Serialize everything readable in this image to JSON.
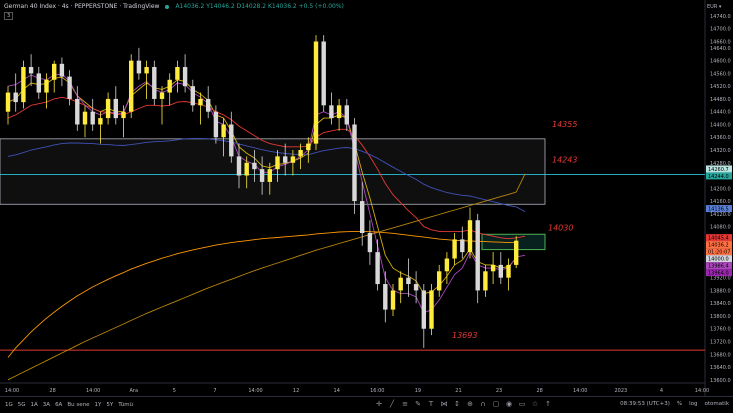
{
  "header": {
    "title": "German 40 Index · 4s · PEPPERSTONE · TradingView",
    "ohlc": "A14036.2  Y14046.2  D14028.2  K14036.2  +0.5 (+0.00%)",
    "badge": "3"
  },
  "currency": "EUR ▾",
  "price_axis": {
    "ticks": [
      "14780.0",
      "14740.0",
      "14700.0",
      "14660.0",
      "14640.0",
      "14600.0",
      "14560.0",
      "14520.0",
      "14480.0",
      "14440.0",
      "14400.0",
      "14360.0",
      "14320.0",
      "14280.0",
      "14240.0",
      "14200.0",
      "14160.0",
      "14120.0",
      "14080.0",
      "14040.0",
      "14000.0",
      "13960.0",
      "13920.0",
      "13880.0",
      "13840.0",
      "13800.0",
      "13760.0",
      "13720.0",
      "13680.0",
      "13640.0",
      "13600.0"
    ],
    "ylim": [
      13590,
      14790
    ]
  },
  "price_labels": [
    {
      "text": "14260.7",
      "value": 14260.7,
      "color": "#b9e3e0"
    },
    {
      "text": "14244.0",
      "value": 14244.0,
      "color": "#26a69a"
    },
    {
      "text": "14136.5",
      "value": 14136.5,
      "color": "#5b7fd6"
    },
    {
      "text": "14045.4",
      "value": 14045.4,
      "color": "#e53935"
    },
    {
      "text": "14036.2",
      "value": 14036.2,
      "color": "#ff7043"
    },
    {
      "text": "01:20:07",
      "value": 14026.0,
      "color": "#ff7043"
    },
    {
      "text": "14000.0",
      "value": 14000.0,
      "color": "#d1d4dc"
    },
    {
      "text": "13986.4",
      "value": 13986.4,
      "color": "#ab47bc"
    },
    {
      "text": "13964.0",
      "value": 13964.0,
      "color": "#9c27b0"
    }
  ],
  "time_axis": {
    "labels": [
      "14:00",
      "28",
      "14:00",
      "Ara",
      "5",
      "7",
      "14:00",
      "12",
      "14",
      "16:00",
      "19",
      "21",
      "23",
      "28",
      "14:00",
      "2023",
      "4",
      "14:00"
    ]
  },
  "annotations": [
    {
      "text": "14355",
      "value": 14355
    },
    {
      "text": "14243",
      "value": 14243
    },
    {
      "text": "14030",
      "value": 14030
    },
    {
      "text": "13693",
      "value": 13693
    }
  ],
  "zones": [
    {
      "name": "upper-zone",
      "top": 14355,
      "bottom": 14150
    },
    {
      "name": "lower-zone",
      "top": 14056,
      "bottom": 14008
    }
  ],
  "lines": [
    {
      "name": "support-line",
      "value": 13693,
      "color": "#e53935"
    },
    {
      "name": "resistance-line",
      "value": 14243,
      "color": "#26c6da"
    }
  ],
  "chart_data": {
    "type": "candlestick",
    "candles": [
      [
        14440,
        14520,
        14400,
        14500
      ],
      [
        14500,
        14560,
        14440,
        14470
      ],
      [
        14470,
        14600,
        14450,
        14580
      ],
      [
        14580,
        14620,
        14520,
        14560
      ],
      [
        14560,
        14580,
        14480,
        14500
      ],
      [
        14500,
        14560,
        14450,
        14540
      ],
      [
        14540,
        14600,
        14500,
        14590
      ],
      [
        14590,
        14610,
        14520,
        14550
      ],
      [
        14550,
        14570,
        14460,
        14480
      ],
      [
        14480,
        14520,
        14380,
        14400
      ],
      [
        14400,
        14460,
        14360,
        14440
      ],
      [
        14440,
        14480,
        14380,
        14400
      ],
      [
        14400,
        14440,
        14340,
        14420
      ],
      [
        14420,
        14500,
        14400,
        14480
      ],
      [
        14480,
        14520,
        14400,
        14420
      ],
      [
        14420,
        14460,
        14360,
        14440
      ],
      [
        14440,
        14620,
        14420,
        14600
      ],
      [
        14600,
        14640,
        14540,
        14560
      ],
      [
        14560,
        14600,
        14480,
        14580
      ],
      [
        14580,
        14600,
        14460,
        14480
      ],
      [
        14480,
        14520,
        14400,
        14500
      ],
      [
        14500,
        14560,
        14460,
        14540
      ],
      [
        14540,
        14600,
        14500,
        14580
      ],
      [
        14580,
        14620,
        14500,
        14520
      ],
      [
        14520,
        14540,
        14440,
        14460
      ],
      [
        14460,
        14500,
        14400,
        14480
      ],
      [
        14480,
        14520,
        14420,
        14440
      ],
      [
        14440,
        14460,
        14340,
        14360
      ],
      [
        14360,
        14420,
        14300,
        14400
      ],
      [
        14400,
        14440,
        14280,
        14300
      ],
      [
        14300,
        14340,
        14200,
        14240
      ],
      [
        14240,
        14300,
        14200,
        14280
      ],
      [
        14280,
        14320,
        14220,
        14260
      ],
      [
        14260,
        14300,
        14180,
        14220
      ],
      [
        14220,
        14280,
        14180,
        14260
      ],
      [
        14260,
        14320,
        14220,
        14300
      ],
      [
        14300,
        14340,
        14240,
        14280
      ],
      [
        14280,
        14320,
        14240,
        14300
      ],
      [
        14300,
        14340,
        14260,
        14320
      ],
      [
        14320,
        14360,
        14280,
        14340
      ],
      [
        14340,
        14680,
        14320,
        14660
      ],
      [
        14660,
        14680,
        14440,
        14460
      ],
      [
        14460,
        14500,
        14400,
        14420
      ],
      [
        14420,
        14480,
        14380,
        14460
      ],
      [
        14460,
        14480,
        14380,
        14400
      ],
      [
        14400,
        14420,
        14120,
        14160
      ],
      [
        14160,
        14220,
        14020,
        14060
      ],
      [
        14060,
        14100,
        13960,
        14000
      ],
      [
        14000,
        14040,
        13880,
        13900
      ],
      [
        13900,
        13940,
        13780,
        13820
      ],
      [
        13820,
        13900,
        13800,
        13880
      ],
      [
        13880,
        13940,
        13840,
        13920
      ],
      [
        13920,
        13980,
        13860,
        13900
      ],
      [
        13900,
        13940,
        13840,
        13880
      ],
      [
        13880,
        13900,
        13700,
        13760
      ],
      [
        13760,
        13900,
        13740,
        13880
      ],
      [
        13880,
        13960,
        13860,
        13940
      ],
      [
        13940,
        14000,
        13900,
        13980
      ],
      [
        13980,
        14060,
        13960,
        14040
      ],
      [
        14040,
        14080,
        13980,
        14000
      ],
      [
        14000,
        14140,
        13980,
        14100
      ],
      [
        14100,
        14120,
        13840,
        13880
      ],
      [
        13880,
        13960,
        13860,
        13940
      ],
      [
        13940,
        14000,
        13900,
        13960
      ],
      [
        13960,
        14000,
        13900,
        13920
      ],
      [
        13920,
        13980,
        13880,
        13960
      ],
      [
        13960,
        14050,
        13950,
        14036
      ]
    ],
    "series": [
      {
        "name": "ema-fast",
        "color": "#d4b106",
        "values": [
          14470,
          14480,
          14510,
          14530,
          14525,
          14528,
          14545,
          14548,
          14530,
          14490,
          14470,
          14450,
          14440,
          14450,
          14440,
          14440,
          14490,
          14510,
          14530,
          14515,
          14510,
          14520,
          14540,
          14535,
          14510,
          14495,
          14475,
          14430,
          14420,
          14380,
          14330,
          14310,
          14295,
          14270,
          14265,
          14275,
          14278,
          14285,
          14295,
          14310,
          14400,
          14420,
          14420,
          14430,
          14420,
          14340,
          14250,
          14170,
          14080,
          13990,
          13950,
          13935,
          13925,
          13910,
          13870,
          13875,
          13895,
          13925,
          13960,
          13975,
          14010,
          13970,
          13960,
          13960,
          13950,
          13955,
          13980
        ]
      },
      {
        "name": "ema-mid",
        "color": "#e53935",
        "values": [
          14420,
          14430,
          14445,
          14460,
          14465,
          14470,
          14480,
          14485,
          14480,
          14470,
          14460,
          14450,
          14440,
          14438,
          14432,
          14430,
          14440,
          14450,
          14460,
          14460,
          14458,
          14460,
          14470,
          14472,
          14468,
          14462,
          14455,
          14440,
          14430,
          14415,
          14395,
          14380,
          14365,
          14350,
          14340,
          14335,
          14330,
          14330,
          14330,
          14332,
          14360,
          14375,
          14380,
          14385,
          14385,
          14365,
          14335,
          14300,
          14260,
          14215,
          14180,
          14155,
          14130,
          14108,
          14080,
          14070,
          14065,
          14065,
          14065,
          14065,
          14070,
          14060,
          14055,
          14050,
          14045,
          14042,
          14045
        ]
      },
      {
        "name": "ema-slow",
        "color": "#3f51b5",
        "values": [
          14300,
          14305,
          14312,
          14320,
          14325,
          14330,
          14336,
          14340,
          14342,
          14342,
          14341,
          14340,
          14338,
          14337,
          14335,
          14334,
          14337,
          14340,
          14344,
          14346,
          14347,
          14349,
          14352,
          14355,
          14356,
          14356,
          14355,
          14352,
          14349,
          14345,
          14339,
          14333,
          14327,
          14321,
          14316,
          14312,
          14309,
          14307,
          14306,
          14305,
          14312,
          14318,
          14322,
          14326,
          14328,
          14324,
          14316,
          14306,
          14294,
          14280,
          14266,
          14253,
          14240,
          14228,
          14213,
          14202,
          14194,
          14187,
          14182,
          14178,
          14176,
          14170,
          14164,
          14158,
          14152,
          14146,
          14142
        ]
      },
      {
        "name": "ema-purple",
        "color": "#ab47bc",
        "values": [
          14520,
          14525,
          14540,
          14555,
          14545,
          14540,
          14555,
          14558,
          14535,
          14490,
          14460,
          14440,
          14430,
          14440,
          14435,
          14435,
          14500,
          14520,
          14535,
          14510,
          14500,
          14510,
          14530,
          14525,
          14500,
          14485,
          14465,
          14410,
          14400,
          14360,
          14300,
          14285,
          14275,
          14250,
          14250,
          14268,
          14275,
          14285,
          14300,
          14320,
          14430,
          14440,
          14430,
          14440,
          14420,
          14320,
          14220,
          14120,
          14020,
          13920,
          13880,
          13870,
          13870,
          13860,
          13810,
          13820,
          13850,
          13890,
          13930,
          13950,
          14000,
          13960,
          13950,
          13950,
          13945,
          13950,
          13985
        ]
      },
      {
        "name": "sma-long",
        "color": "#ff9800",
        "values": [
          13670,
          13700,
          13725,
          13750,
          13772,
          13793,
          13812,
          13830,
          13847,
          13863,
          13877,
          13891,
          13903,
          13915,
          13926,
          13936,
          13947,
          13956,
          13965,
          13973,
          13981,
          13988,
          13995,
          14001,
          14007,
          14012,
          14017,
          14022,
          14026,
          14030,
          14033,
          14036,
          14039,
          14042,
          14044,
          14046,
          14048,
          14050,
          14052,
          14054,
          14057,
          14059,
          14061,
          14063,
          14064,
          14065,
          14065,
          14064,
          14063,
          14061,
          14059,
          14056,
          14053,
          14050,
          14047,
          14044,
          14041,
          14039,
          14037,
          14036,
          14035,
          14034,
          14033,
          14032,
          14031,
          14030,
          14030
        ]
      },
      {
        "name": "sma-longer",
        "color": "#b8860b",
        "values": [
          13600,
          13612,
          13624,
          13636,
          13648,
          13660,
          13672,
          13684,
          13696,
          13708,
          13720,
          13731,
          13742,
          13753,
          13764,
          13775,
          13786,
          13797,
          13808,
          13818,
          13828,
          13838,
          13848,
          13858,
          13868,
          13878,
          13888,
          13897,
          13906,
          13915,
          13924,
          13933,
          13942,
          13950,
          13958,
          13966,
          13974,
          13982,
          13990,
          13998,
          14006,
          14013,
          14020,
          14027,
          14034,
          14041,
          14048,
          14055,
          14062,
          14069,
          14076,
          14083,
          14090,
          14097,
          14104,
          14111,
          14118,
          14125,
          14132,
          14139,
          14146,
          14153,
          14160,
          14167,
          14174,
          14181,
          14188
        ]
      }
    ],
    "projections": [
      {
        "name": "sma-longer-proj",
        "color": "#b8860b",
        "values": [
          14188,
          14245
        ]
      },
      {
        "name": "ema-slow-proj",
        "color": "#3f51b5",
        "values": [
          14142,
          14127
        ]
      },
      {
        "name": "ema-mid-proj",
        "color": "#e53935",
        "values": [
          14045,
          14050
        ]
      },
      {
        "name": "ema-purple-proj",
        "color": "#ab47bc",
        "values": [
          13985,
          13990
        ]
      }
    ]
  },
  "bottom_bar": {
    "timeframes": [
      "1G",
      "5G",
      "1A",
      "3A",
      "6A",
      "Bu sene",
      "1Y",
      "5Y",
      "Tümü"
    ],
    "tools": [
      "cursor-icon",
      "trendline-icon",
      "fib-icon",
      "brush-icon",
      "text-icon",
      "pattern-icon",
      "measure-icon",
      "zoom-icon",
      "magnet-icon",
      "lock-icon",
      "hide-icon",
      "trash-icon",
      "star-icon",
      "arrow-icon"
    ],
    "time": "08:39:53 (UTC+3)",
    "pct": "%",
    "log": "log",
    "auto": "otomatik"
  }
}
